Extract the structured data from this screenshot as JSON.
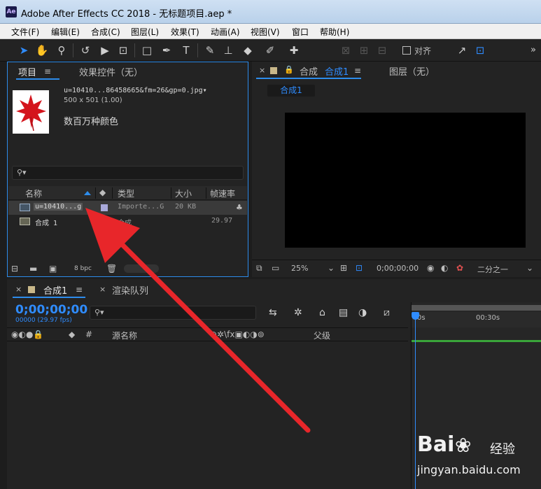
{
  "window": {
    "app_logo": "Ae",
    "title": "Adobe After Effects CC 2018 - 无标题项目.aep *"
  },
  "menu": [
    "文件(F)",
    "编辑(E)",
    "合成(C)",
    "图层(L)",
    "效果(T)",
    "动画(A)",
    "视图(V)",
    "窗口",
    "帮助(H)"
  ],
  "toolbar": {
    "tools": [
      "selection-tool",
      "hand-tool",
      "zoom-tool",
      "rotate-tool",
      "camera-tool",
      "pan-behind-tool",
      "rectangle-tool",
      "pen-tool",
      "type-tool",
      "brush-tool",
      "clone-stamp-tool",
      "eraser-tool",
      "roto-brush-tool",
      "puppet-tool"
    ],
    "snap_label": "对齐",
    "more": "»"
  },
  "project": {
    "tab_label": "项目",
    "effects_tab_label": "效果控件（无）",
    "file_name": "u=10410...86458665&fm=26&gp=0.jpg▾",
    "file_dims": "500 x 501 (1.00)",
    "file_colors": "数百万种颜色",
    "columns": {
      "name": "名称",
      "type": "类型",
      "size": "大小",
      "fps": "帧速率"
    },
    "items": [
      {
        "name": "u=10410...g",
        "type": "Importe...G",
        "size": "20 KB",
        "fps": ""
      },
      {
        "name": "合成 1",
        "type": "合成",
        "size": "",
        "fps": "29.97"
      }
    ],
    "bpc": "8 bpc"
  },
  "composition": {
    "close": "×",
    "tab_prefix": "合成",
    "tab_label": "合成1",
    "layer_tab_label": "图层（无）",
    "sub_tab": "合成1",
    "zoom": "25%",
    "timecode": "0;00;00;00",
    "resolution": "二分之一"
  },
  "timeline": {
    "close": "×",
    "tab_label": "合成1",
    "render_tab_label": "渲染队列",
    "timecode": "0;00;00;00",
    "timecode_sub": "00000 (29.97 fps)",
    "source_name_label": "源名称",
    "parent_label": "父级",
    "hash": "#",
    "ruler": [
      "0s",
      "00:30s"
    ]
  },
  "watermark": {
    "logo": "Bai",
    "logo_suffix": "经验",
    "url": "jingyan.baidu.com"
  }
}
